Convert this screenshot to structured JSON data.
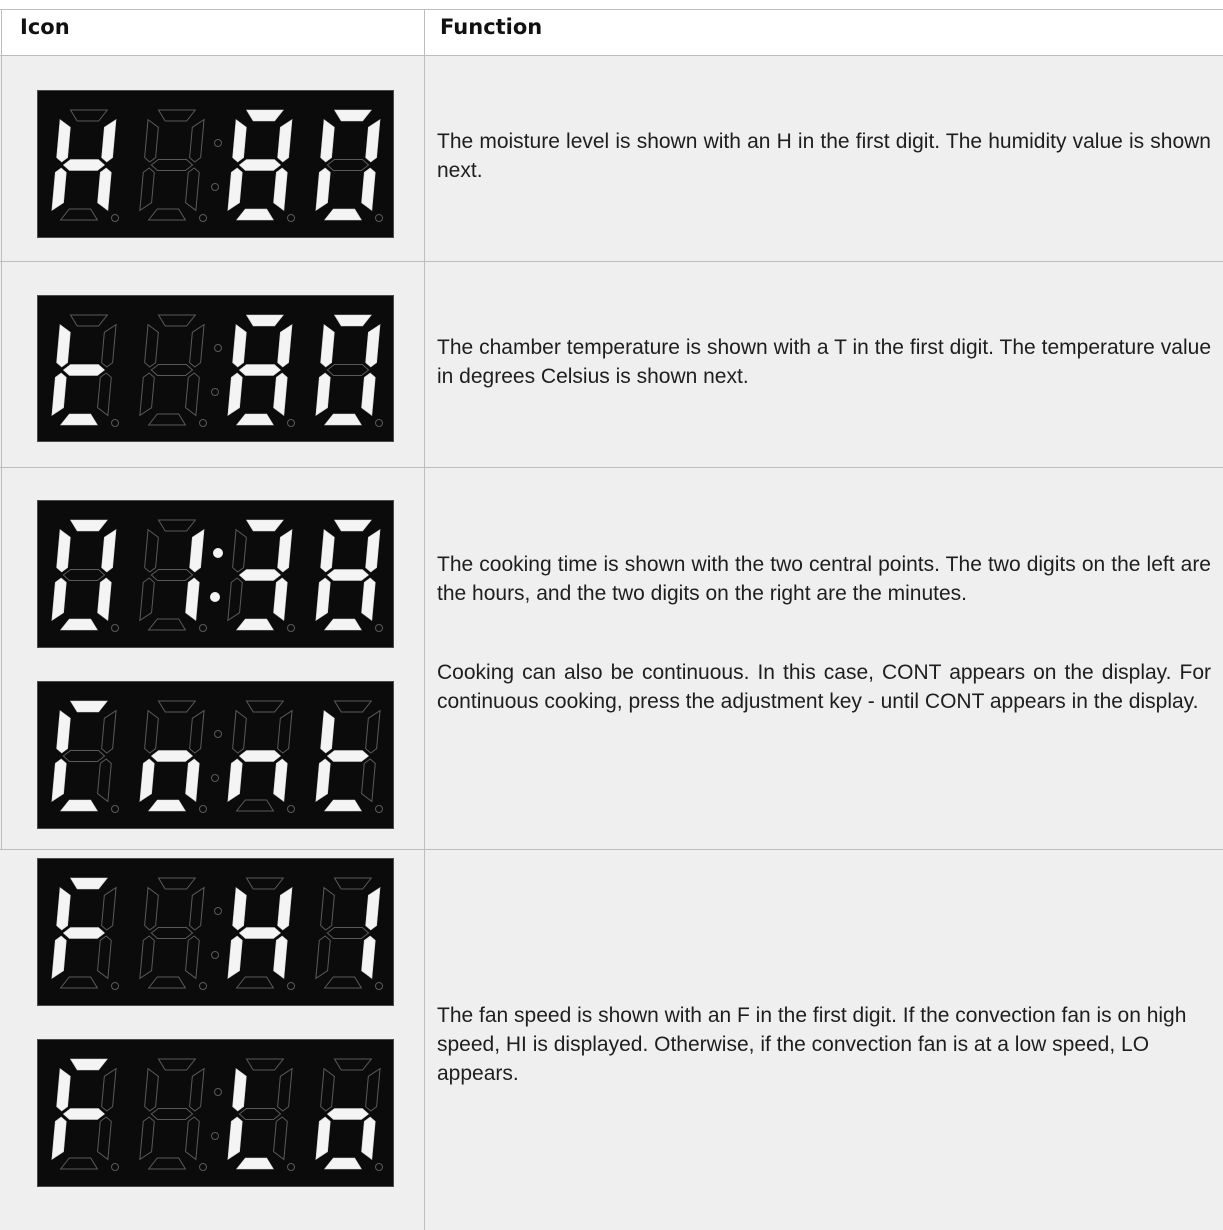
{
  "table": {
    "headers": {
      "icon": "Icon",
      "function": "Function"
    },
    "rows": [
      {
        "displays": [
          {
            "digits": [
              "H",
              "",
              "8",
              "0"
            ],
            "colon": false
          }
        ],
        "paragraphs": [
          "The moisture level is shown with an H in the first digit. The humidity value is shown next."
        ]
      },
      {
        "displays": [
          {
            "digits": [
              "t",
              "",
              "8",
              "0"
            ],
            "colon": false
          }
        ],
        "paragraphs": [
          "The chamber temperature is shown with a T in the first digit. The temperature value in degrees Celsius is shown next."
        ]
      },
      {
        "displays": [
          {
            "digits": [
              "0",
              "1",
              "3",
              "8"
            ],
            "colon": true
          },
          {
            "digits": [
              "C",
              "o",
              "n",
              "t"
            ],
            "colon": false
          }
        ],
        "paragraphs": [
          "The cooking time is shown with the two central points. The two digits on the left are the hours, and the two digits on the right are the minutes.",
          "Cooking can also be continuous. In this case, CONT appears on the display. For continuous cooking, press the adjustment key - until CONT appears in the display."
        ]
      },
      {
        "displays": [
          {
            "digits": [
              "F",
              "",
              "H",
              "I"
            ],
            "colon": false
          },
          {
            "digits": [
              "F",
              "",
              "L",
              "o"
            ],
            "colon": false
          }
        ],
        "paragraphs": [
          "The fan speed is shown with an F in the first digit. If the convection fan is on high speed, HI is displayed. Otherwise, if the convection fan is at a low speed, LO appears."
        ]
      }
    ]
  }
}
